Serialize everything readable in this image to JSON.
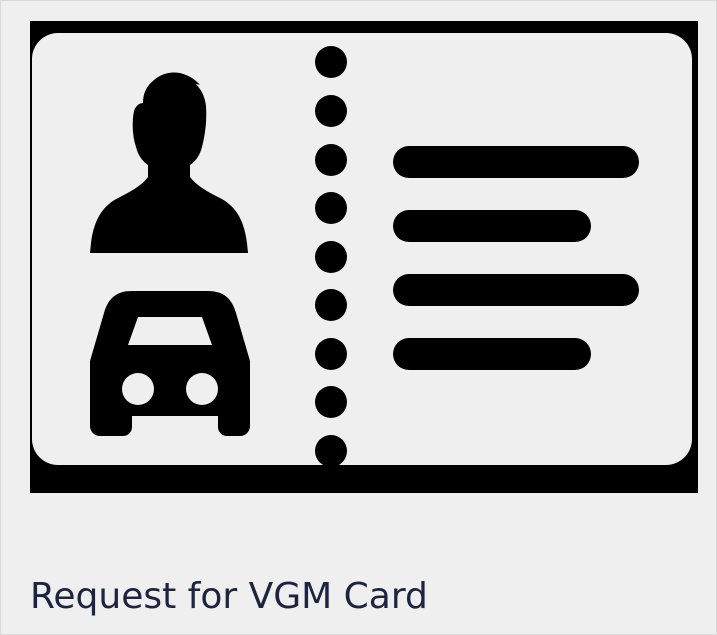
{
  "tile": {
    "label": "Request for VGM Card",
    "icon": "id-card-driver-icon",
    "colors": {
      "background": "#efefef",
      "icon": "#000000",
      "label": "#1c2440"
    }
  }
}
